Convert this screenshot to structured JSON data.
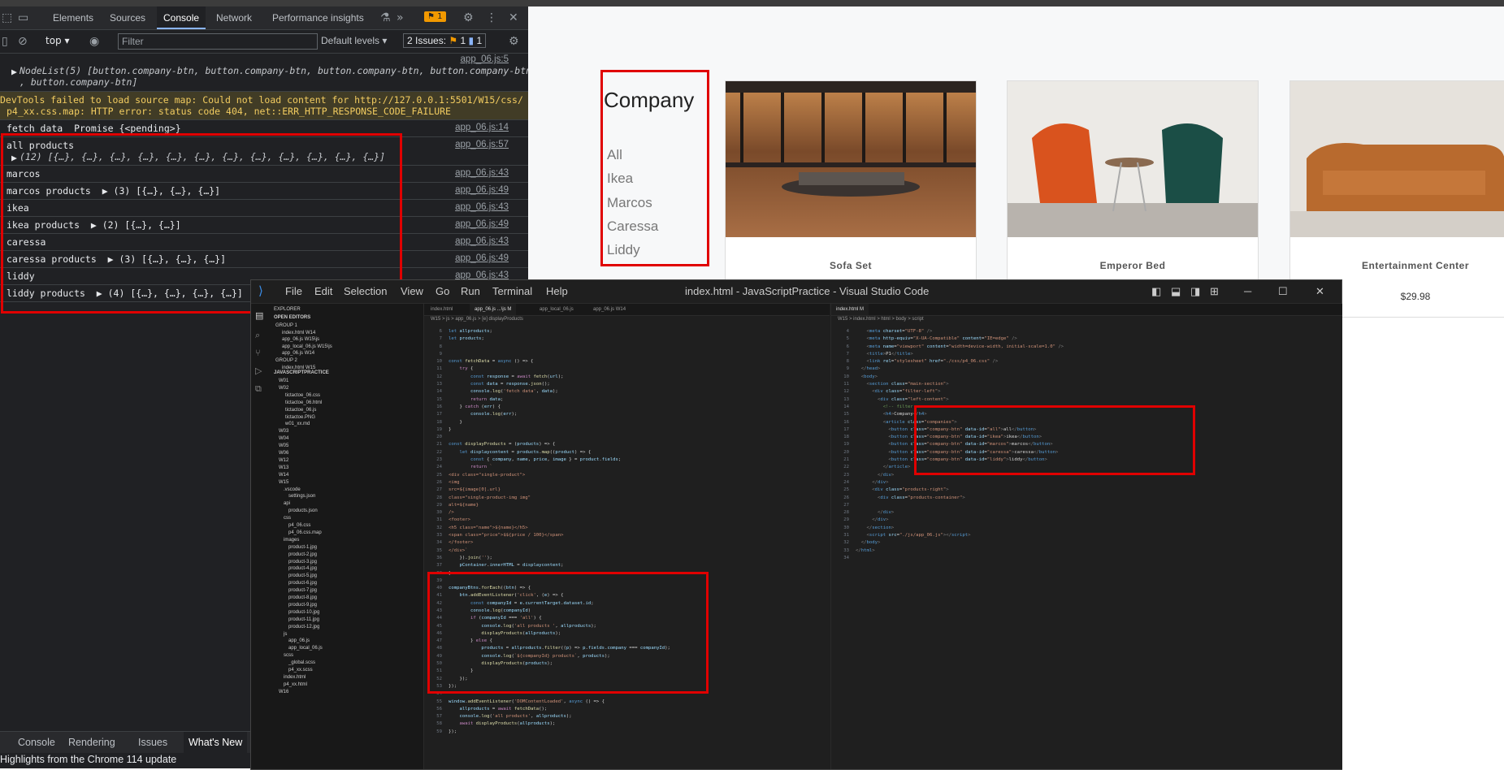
{
  "devtools": {
    "tabs": [
      "Elements",
      "Sources",
      "Console",
      "Network",
      "Performance insights"
    ],
    "issues_badge": "1",
    "context": "top",
    "filter_placeholder": "Filter",
    "levels": "Default levels",
    "issues_label": "2 Issues:",
    "issue_warn_count": "1",
    "issue_info_count": "1",
    "console_rows": [
      {
        "text": "NodeList(5) [button.company-btn, button.company-btn, button.company-btn, button.company-btn",
        "text2": ", button.company-btn]",
        "src": "app_06.js:5"
      },
      {
        "text": "DevTools failed to load source map: Could not load content for http://127.0.0.1:5501/W15/css/",
        "text2": "p4_xx.css.map: HTTP error: status code 404, net::ERR_HTTP_RESPONSE_CODE_FAILURE",
        "src": ""
      },
      {
        "text": "fetch data  Promise {<pending>}",
        "src": "app_06.js:14"
      },
      {
        "text": "all products",
        "text2": "(12) [{…}, {…}, {…}, {…}, {…}, {…}, {…}, {…}, {…}, {…}, {…}, {…}]",
        "src": "app_06.js:57"
      },
      {
        "text": "marcos",
        "src": "app_06.js:43"
      },
      {
        "text": "marcos products  ▶ (3) [{…}, {…}, {…}]",
        "src": "app_06.js:49"
      },
      {
        "text": "ikea",
        "src": "app_06.js:43"
      },
      {
        "text": "ikea products  ▶ (2) [{…}, {…}]",
        "src": "app_06.js:49"
      },
      {
        "text": "caressa",
        "src": "app_06.js:43"
      },
      {
        "text": "caressa products  ▶ (3) [{…}, {…}, {…}]",
        "src": "app_06.js:49"
      },
      {
        "text": "liddy",
        "src": "app_06.js:43"
      },
      {
        "text": "liddy products  ▶ (4) [{…}, {…}, {…}, {…}]",
        "src": "app_06.js:49"
      }
    ],
    "drawer_tabs": [
      "Console",
      "Rendering",
      "Issues",
      "What's New"
    ],
    "drawer_text": "Highlights from the Chrome 114 update"
  },
  "page": {
    "company_title": "Company",
    "companies": [
      "All",
      "Ikea",
      "Marcos",
      "Caressa",
      "Liddy"
    ],
    "products": [
      {
        "name": "Sofa Set",
        "price": ""
      },
      {
        "name": "Emperor Bed",
        "price": ""
      },
      {
        "name": "Entertainment Center",
        "price": "$29.98"
      }
    ]
  },
  "vscode": {
    "menu": [
      "File",
      "Edit",
      "Selection",
      "View",
      "Go",
      "Run",
      "Terminal",
      "Help"
    ],
    "window_title": "index.html - JavaScriptPractice - Visual Studio Code",
    "explorer_header": "EXPLORER",
    "open_editors": "OPEN EDITORS",
    "workspace": "JAVASCRIPTPRACTICE",
    "files": [
      "GROUP 1",
      "index.html W14",
      "app_06.js W15\\js",
      "app_local_06.js W15\\js",
      "app_06.js W14",
      "GROUP 2",
      "index.html W15",
      "W01",
      "W02",
      "tictactoe_06.css",
      "tictactoe_06.html",
      "tictactoe_06.js",
      "tictactoe.PNG",
      "w01_xx.md",
      "W03",
      "W04",
      "W05",
      "W06",
      "W12",
      "W13",
      "W14",
      "W15",
      ".vscode",
      "settings.json",
      "api",
      "products.json",
      "css",
      "p4_06.css",
      "p4_06.css.map",
      "images",
      "product-1.jpg",
      "product-2.jpg",
      "product-3.jpg",
      "product-4.jpg",
      "product-5.jpg",
      "product-6.jpg",
      "product-7.jpg",
      "product-8.jpg",
      "product-9.jpg",
      "product-10.jpg",
      "product-11.jpg",
      "product-12.jpg",
      "js",
      "app_06.js",
      "app_local_06.js",
      "scss",
      "_global.scss",
      "p4_xx.scss",
      "index.html",
      "p4_xx.html",
      "W16"
    ],
    "left_tabs": [
      "index.html",
      "app_06.js ...\\js M",
      "app_local_06.js",
      "app_06.js W14"
    ],
    "left_breadcrumb": "W15 > js > app_06.js > [e] displayProducts",
    "right_tabs": [
      "index.html M"
    ],
    "right_breadcrumb": "W15 > index.html > html > body > script"
  }
}
